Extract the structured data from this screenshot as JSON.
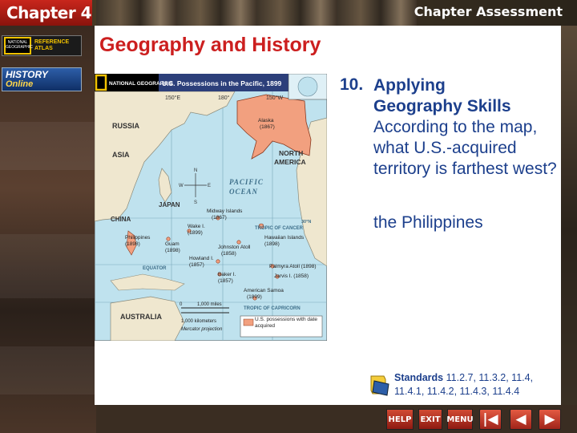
{
  "header": {
    "chapter_label": "Chapter 4",
    "assessment_label": "Chapter Assessment"
  },
  "sidebar": {
    "atlas_logo_text": "NATIONAL GEOGRAPHIC",
    "atlas_label": "REFERENCE ATLAS",
    "history_label": "HISTORY",
    "online_label": "Online"
  },
  "slide": {
    "heading": "Geography and History",
    "question_number": "10.",
    "question_title_line1": "Applying",
    "question_title_line2": "Geography Skills",
    "question_text": "According to the map, what U.S.-acquired territory is farthest west?",
    "answer": "the Philippines"
  },
  "map": {
    "brand": "NATIONAL GEOGRAPHIC",
    "title": "U.S. Possessions in the Pacific, 1899",
    "longitudes": [
      "150°E",
      "180°",
      "150°W"
    ],
    "regions": {
      "russia": "RUSSIA",
      "asia": "ASIA",
      "china": "CHINA",
      "japan": "JAPAN",
      "australia": "AUSTRALIA",
      "north_america_1": "NORTH",
      "north_america_2": "AMERICA",
      "pacific_1": "PACIFIC",
      "pacific_2": "OCEAN"
    },
    "lines": {
      "tropic_cancer": "TROPIC OF CANCER",
      "tropic_capricorn": "TROPIC OF CAPRICORN",
      "equator": "EQUATOR",
      "lat30": "30°N"
    },
    "places": {
      "alaska": "Alaska",
      "alaska_year": "(1867)",
      "midway": "Midway Islands",
      "midway_year": "(1867)",
      "wake": "Wake I.",
      "wake_year": "(1899)",
      "hawaii": "Hawaiian Islands",
      "hawaii_year": "(1898)",
      "philippines": "Philippines",
      "philippines_year": "(1898)",
      "guam": "Guam",
      "guam_year": "(1898)",
      "johnston": "Johnston Atoll",
      "johnston_year": "(1858)",
      "howland": "Howland I.",
      "howland_year": "(1857)",
      "palmyra": "Palmyra Atoll (1898)",
      "jarvis": "Jarvis I. (1858)",
      "baker": "Baker I.",
      "baker_year": "(1857)",
      "samoa": "American Samoa",
      "samoa_year": "(1899)"
    },
    "compass": {
      "n": "N",
      "s": "S",
      "e": "E",
      "w": "W"
    },
    "scale": {
      "zero": "0",
      "miles": "1,000 miles",
      "km": "1,000 kilometers",
      "projection": "Mercator projection"
    },
    "legend": "U.S. possessions with date acquired"
  },
  "standards": {
    "label": "Standards",
    "codes": "11.2.7, 11.3.2, 11.4, 11.4.1, 11.4.2, 11.4.3, 11.4.4"
  },
  "nav": {
    "help": "HELP",
    "exit": "EXIT",
    "menu": "MENU",
    "first": "|◀",
    "prev": "◀",
    "next": "▶"
  },
  "colors": {
    "heading": "#cc1f1f",
    "question_text": "#1c3f8c",
    "ocean": "#bfe2ee",
    "land": "#efe7cf",
    "us_possession": "#f2a07f",
    "map_title_bar": "#2c3f7a"
  }
}
